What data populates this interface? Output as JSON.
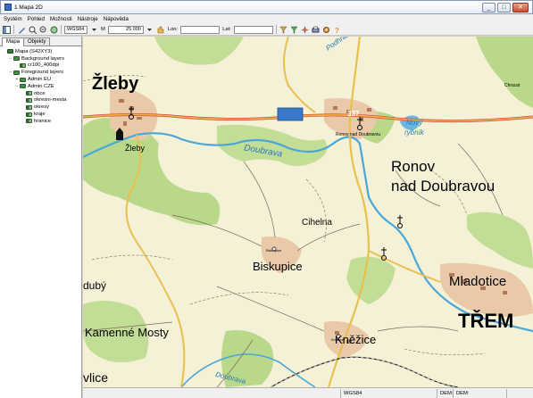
{
  "window": {
    "title": "1 Mapa 2D",
    "minimize": "_",
    "maximize": "□",
    "close": "✕"
  },
  "menu": {
    "items": [
      "Systém",
      "Pohled",
      "Možnosti",
      "Nástroje",
      "Nápověda"
    ]
  },
  "toolbar": {
    "crs_value": "WGS84",
    "scale_label": "M",
    "scale_value": "25 000",
    "lon_label": "Lon:",
    "lat_label": "Lat:",
    "icons": [
      "panel-icon",
      "draw-icon",
      "zoom-in-icon",
      "zoom-out-icon",
      "pan-icon",
      "hand-icon",
      "filter-icon",
      "funnel-icon",
      "compass-icon",
      "print-icon",
      "settings-icon",
      "help-icon"
    ]
  },
  "panel": {
    "tabs": [
      "Mapa",
      "Objekty"
    ],
    "tree": [
      {
        "label": "Mapa (S42XY3)",
        "level": 0,
        "icon": "root"
      },
      {
        "label": "Background layers",
        "level": 1,
        "icon": "group",
        "expanded": true
      },
      {
        "label": "cr100_400dpi",
        "level": 2,
        "icon": "item"
      },
      {
        "label": "Foreground layers",
        "level": 1,
        "icon": "group",
        "expanded": true
      },
      {
        "label": "Admin EU",
        "level": 2,
        "icon": "group",
        "expanded": false
      },
      {
        "label": "Admin CZE",
        "level": 2,
        "icon": "group",
        "expanded": true
      },
      {
        "label": "obce",
        "level": 3,
        "icon": "item"
      },
      {
        "label": "okresni-mesta",
        "level": 3,
        "icon": "item"
      },
      {
        "label": "okresy",
        "level": 3,
        "icon": "item"
      },
      {
        "label": "kraje",
        "level": 3,
        "icon": "item"
      },
      {
        "label": "hranice",
        "level": 3,
        "icon": "item"
      }
    ]
  },
  "map": {
    "road_number": "337",
    "labels": {
      "zleby_big": "Žleby",
      "zleby_small": "Žleby",
      "ronov": "Ronov",
      "nad_doubravou": "nad Doubravou",
      "ronov_small": "Ronov nad Doubravou",
      "novy_rybnik_1": "Nový",
      "novy_rybnik_2": "rybník",
      "doubrava": "Doubrava",
      "doubrava_bottom": "Doubrava",
      "cihelna": "Cihelna",
      "biskupice": "Biskupice",
      "biskupice_small": "Biskupice",
      "mladotice": "Mladotice",
      "tremosnice": "TŘEM",
      "kamenne_mosty": "Kamenné Mosty",
      "knezice": "Kněžice",
      "knezice_small": "Kněžice",
      "dub": "dubý",
      "vlice": "vlice",
      "podhradi": "Podhradí",
      "chraust": "Chraust"
    }
  },
  "status": {
    "crs": "WGS84",
    "dem_label": "DEM:",
    "dem2_label": "DEM:"
  }
}
